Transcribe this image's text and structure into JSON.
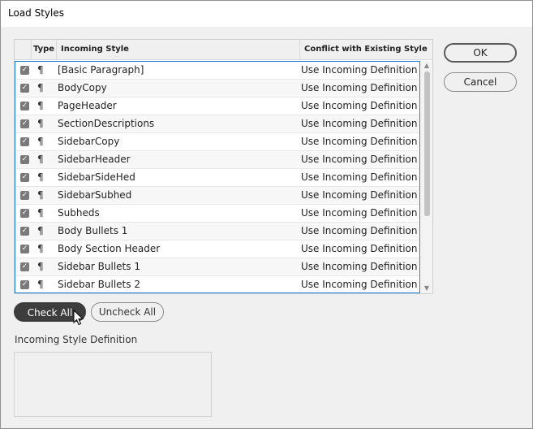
{
  "window": {
    "title": "Load Styles"
  },
  "table": {
    "headers": {
      "type": "Type",
      "incoming": "Incoming Style",
      "conflict": "Conflict with Existing Style"
    },
    "rows": [
      {
        "checked": true,
        "type_icon": "paragraph-icon",
        "type_glyph": "¶",
        "name": "[Basic Paragraph]",
        "conflict": "Use Incoming Definition"
      },
      {
        "checked": true,
        "type_icon": "paragraph-icon",
        "type_glyph": "¶",
        "name": "BodyCopy",
        "conflict": "Use Incoming Definition"
      },
      {
        "checked": true,
        "type_icon": "paragraph-icon",
        "type_glyph": "¶",
        "name": "PageHeader",
        "conflict": "Use Incoming Definition"
      },
      {
        "checked": true,
        "type_icon": "paragraph-icon",
        "type_glyph": "¶",
        "name": "SectionDescriptions",
        "conflict": "Use Incoming Definition"
      },
      {
        "checked": true,
        "type_icon": "paragraph-icon",
        "type_glyph": "¶",
        "name": "SidebarCopy",
        "conflict": "Use Incoming Definition"
      },
      {
        "checked": true,
        "type_icon": "paragraph-icon",
        "type_glyph": "¶",
        "name": "SidebarHeader",
        "conflict": "Use Incoming Definition"
      },
      {
        "checked": true,
        "type_icon": "paragraph-icon",
        "type_glyph": "¶",
        "name": "SidebarSideHed",
        "conflict": "Use Incoming Definition"
      },
      {
        "checked": true,
        "type_icon": "paragraph-icon",
        "type_glyph": "¶",
        "name": "SidebarSubhed",
        "conflict": "Use Incoming Definition"
      },
      {
        "checked": true,
        "type_icon": "paragraph-icon",
        "type_glyph": "¶",
        "name": "Subheds",
        "conflict": "Use Incoming Definition"
      },
      {
        "checked": true,
        "type_icon": "paragraph-icon",
        "type_glyph": "¶",
        "name": "Body Bullets 1",
        "conflict": "Use Incoming Definition"
      },
      {
        "checked": true,
        "type_icon": "paragraph-icon",
        "type_glyph": "¶",
        "name": "Body Section Header",
        "conflict": "Use Incoming Definition"
      },
      {
        "checked": true,
        "type_icon": "paragraph-icon",
        "type_glyph": "¶",
        "name": "Sidebar Bullets 1",
        "conflict": "Use Incoming Definition"
      },
      {
        "checked": true,
        "type_icon": "paragraph-icon",
        "type_glyph": "¶",
        "name": "Sidebar Bullets 2",
        "conflict": "Use Incoming Definition"
      }
    ]
  },
  "buttons": {
    "ok": "OK",
    "cancel": "Cancel",
    "check_all": "Check All",
    "uncheck_all": "Uncheck All"
  },
  "definition": {
    "label": "Incoming Style Definition",
    "text": ""
  },
  "colors": {
    "selection_border": "#1e7fd6",
    "primary_button": "#3d3d3d",
    "checkbox": "#7a7a7a"
  }
}
